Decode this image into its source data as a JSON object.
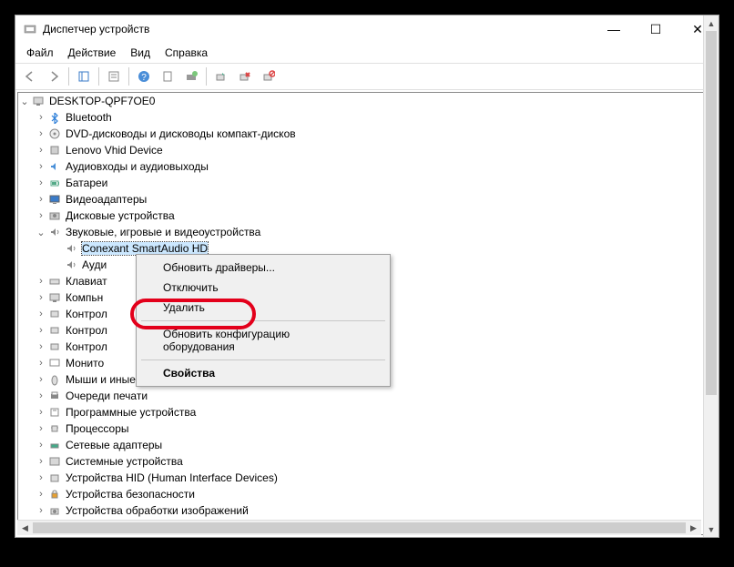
{
  "window": {
    "title": "Диспетчер устройств",
    "minimize": "—",
    "maximize": "☐",
    "close": "✕"
  },
  "menu": {
    "file": "Файл",
    "action": "Действие",
    "view": "Вид",
    "help": "Справка"
  },
  "tree": {
    "root": "DESKTOP-QPF7OE0",
    "nodes": [
      {
        "icon": "bluetooth",
        "label": "Bluetooth"
      },
      {
        "icon": "disc",
        "label": "DVD-дисководы и дисководы компакт-дисков"
      },
      {
        "icon": "device",
        "label": "Lenovo Vhid Device"
      },
      {
        "icon": "audio",
        "label": "Аудиовходы и аудиовыходы"
      },
      {
        "icon": "battery",
        "label": "Батареи"
      },
      {
        "icon": "display",
        "label": "Видеоадаптеры"
      },
      {
        "icon": "disk",
        "label": "Дисковые устройства"
      }
    ],
    "expanded": {
      "label": "Звуковые, игровые и видеоустройства",
      "children": [
        {
          "icon": "sound",
          "label": "Conexant SmartAudio HD",
          "selected": true
        },
        {
          "icon": "sound",
          "label": "Ауди"
        }
      ]
    },
    "after": [
      {
        "icon": "keyboard",
        "label": "Клавиат"
      },
      {
        "icon": "computer",
        "label": "Компьн"
      },
      {
        "icon": "controller",
        "label": "Контрол"
      },
      {
        "icon": "controller",
        "label": "Контрол"
      },
      {
        "icon": "controller",
        "label": "Контрол"
      },
      {
        "icon": "monitor",
        "label": "Монито"
      },
      {
        "icon": "mouse",
        "label": "Мыши и иные указывающие устройства"
      },
      {
        "icon": "printer",
        "label": "Очереди печати"
      },
      {
        "icon": "software",
        "label": "Программные устройства"
      },
      {
        "icon": "cpu",
        "label": "Процессоры"
      },
      {
        "icon": "network",
        "label": "Сетевые адаптеры"
      },
      {
        "icon": "system",
        "label": "Системные устройства"
      },
      {
        "icon": "hid",
        "label": "Устройства HID (Human Interface Devices)"
      },
      {
        "icon": "security",
        "label": "Устройства безопасности"
      },
      {
        "icon": "imaging",
        "label": "Устройства обработки изображений"
      }
    ]
  },
  "context_menu": {
    "update": "Обновить драйверы...",
    "disable": "Отключить",
    "remove": "Удалить",
    "scan": "Обновить конфигурацию оборудования",
    "properties": "Свойства"
  }
}
